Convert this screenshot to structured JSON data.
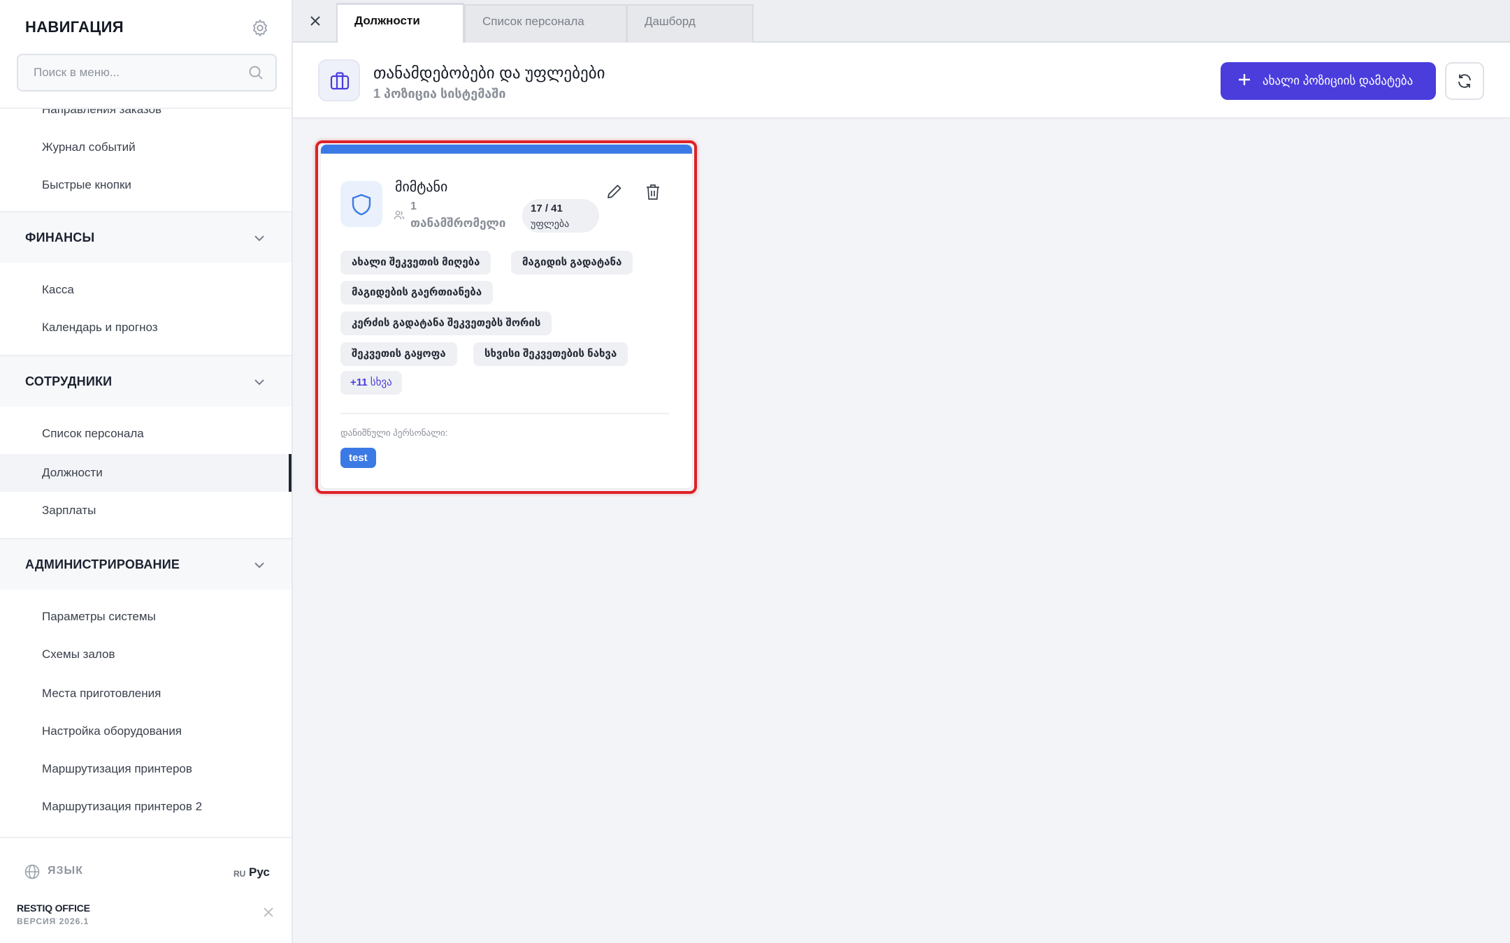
{
  "sidebar": {
    "title": "НАВИГАЦИЯ",
    "search_placeholder": "Поиск в меню...",
    "items_top": [
      "Направления заказов",
      "Журнал событий",
      "Быстрые кнопки"
    ],
    "sections": [
      {
        "label": "ФИНАНСЫ",
        "items": [
          "Касса",
          "Календарь и прогноз"
        ]
      },
      {
        "label": "СОТРУДНИКИ",
        "items": [
          "Список персонала",
          "Должности",
          "Зарплаты"
        ]
      },
      {
        "label": "АДМИНИСТРИРОВАНИЕ",
        "items": [
          "Параметры системы",
          "Схемы залов",
          "Места приготовления",
          "Настройка оборудования",
          "Маршрутизация принтеров",
          "Маршрутизация принтеров 2"
        ]
      }
    ],
    "footer": {
      "lang_label": "ЯЗЫК",
      "lang_code": "RU",
      "lang_value": "Рус",
      "brand": "RESTIQ OFFICE",
      "version": "ВЕРСИЯ 2026.1"
    }
  },
  "tabs": [
    "Должности",
    "Список персонала",
    "Дашборд"
  ],
  "header": {
    "title": "თანამდებობები და უფლებები",
    "subtitle": "1 პოზიცია სისტემაში",
    "add_button": "ახალი პოზიციის დამატება"
  },
  "card": {
    "name": "მიმტანი",
    "employees_count": "1",
    "employees_label": "თანამშრომელი",
    "permissions_count": "17 / 41",
    "permissions_label": "უფლება",
    "permissions": [
      "ახალი შეკვეთის მიღება",
      "მაგიდის გადატანა",
      "მაგიდების გაერთიანება",
      "კერძის გადატანა შეკვეთებს შორის",
      "შეკვეთის გაყოფა",
      "სხვისი შეკვეთების ნახვა"
    ],
    "more_count": "+11",
    "more_label": "სხვა",
    "assigned_label": "დანიშნული პერსონალი:",
    "assigned_staff": [
      "test"
    ]
  },
  "colors": {
    "accent": "#4a3ddc",
    "card_bar": "#3b7ae4",
    "highlight": "#dd2228"
  }
}
